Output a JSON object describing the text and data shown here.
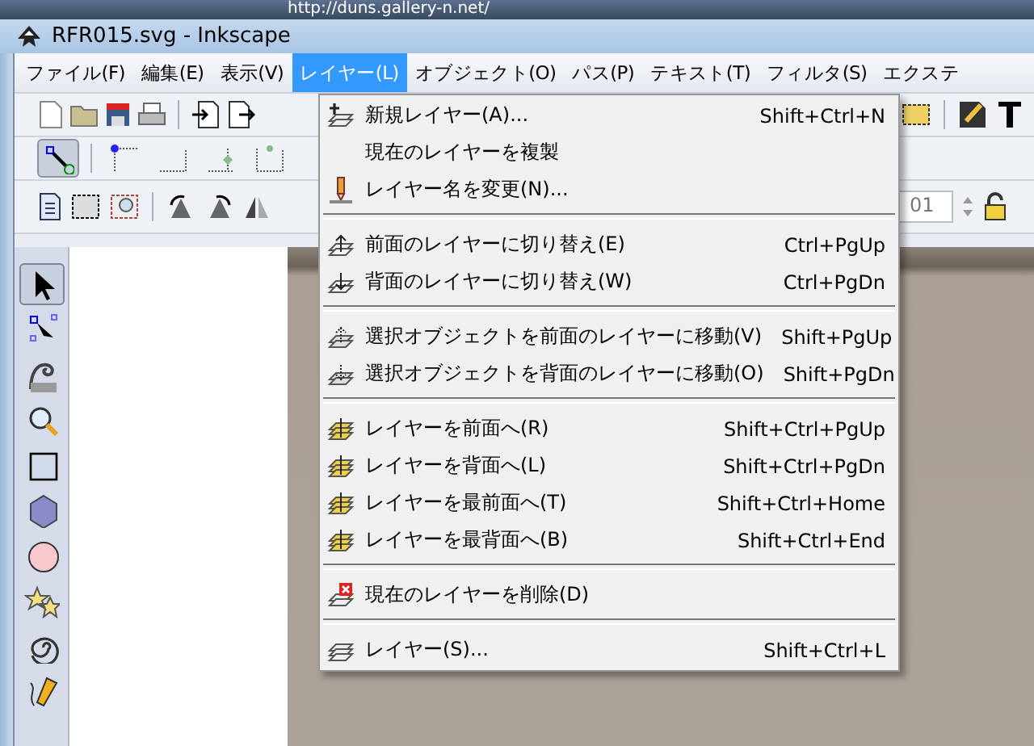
{
  "taskbar": {
    "address": "http://duns.gallery-n.net/"
  },
  "window": {
    "title": "RFR015.svg - Inkscape"
  },
  "menubar": [
    {
      "label": "ファイル(F)",
      "selected": false
    },
    {
      "label": "編集(E)",
      "selected": false
    },
    {
      "label": "表示(V)",
      "selected": false
    },
    {
      "label": "レイヤー(L)",
      "selected": true
    },
    {
      "label": "オブジェクト(O)",
      "selected": false
    },
    {
      "label": "パス(P)",
      "selected": false
    },
    {
      "label": "テキスト(T)",
      "selected": false
    },
    {
      "label": "フィルタ(S)",
      "selected": false
    },
    {
      "label": "エクステ",
      "selected": false
    }
  ],
  "snap_bar": [
    {
      "on": true
    },
    {
      "on": false
    },
    {
      "on": false
    },
    {
      "on": false
    },
    {
      "on": false
    }
  ],
  "coordinate_field": {
    "value": "01"
  },
  "toolbox": [
    {
      "selected": true
    },
    {
      "selected": false
    },
    {
      "selected": false
    },
    {
      "selected": false
    },
    {
      "selected": false
    },
    {
      "selected": false
    },
    {
      "selected": false
    },
    {
      "selected": false
    },
    {
      "selected": false
    },
    {
      "selected": false
    }
  ],
  "layer_menu": [
    {
      "kind": "item",
      "label": "新規レイヤー(A)...",
      "shortcut": "Shift+Ctrl+N"
    },
    {
      "kind": "item",
      "label": "現在のレイヤーを複製"
    },
    {
      "kind": "item",
      "label": "レイヤー名を変更(N)..."
    },
    {
      "kind": "separator"
    },
    {
      "kind": "item",
      "label": "前面のレイヤーに切り替え(E)",
      "shortcut": "Ctrl+PgUp"
    },
    {
      "kind": "item",
      "label": "背面のレイヤーに切り替え(W)",
      "shortcut": "Ctrl+PgDn"
    },
    {
      "kind": "separator"
    },
    {
      "kind": "item",
      "label": "選択オブジェクトを前面のレイヤーに移動(V)",
      "shortcut": "Shift+PgUp"
    },
    {
      "kind": "item",
      "label": "選択オブジェクトを背面のレイヤーに移動(O)",
      "shortcut": "Shift+PgDn"
    },
    {
      "kind": "separator"
    },
    {
      "kind": "item",
      "label": "レイヤーを前面へ(R)",
      "shortcut": "Shift+Ctrl+PgUp"
    },
    {
      "kind": "item",
      "label": "レイヤーを背面へ(L)",
      "shortcut": "Shift+Ctrl+PgDn"
    },
    {
      "kind": "item",
      "label": "レイヤーを最前面へ(T)",
      "shortcut": "Shift+Ctrl+Home"
    },
    {
      "kind": "item",
      "label": "レイヤーを最背面へ(B)",
      "shortcut": "Shift+Ctrl+End"
    },
    {
      "kind": "separator"
    },
    {
      "kind": "item",
      "label": "現在のレイヤーを削除(D)"
    },
    {
      "kind": "separator"
    },
    {
      "kind": "item",
      "label": "レイヤー(S)...",
      "shortcut": "Shift+Ctrl+L"
    }
  ]
}
